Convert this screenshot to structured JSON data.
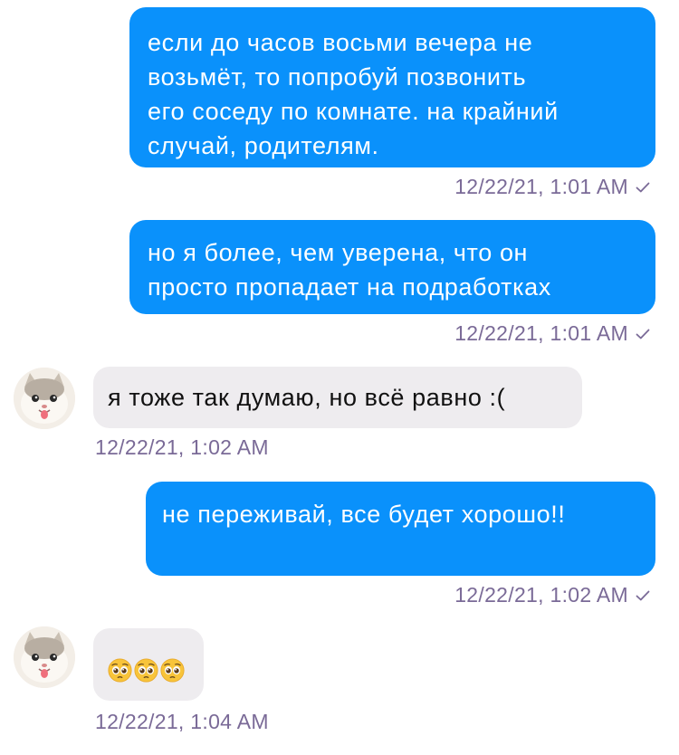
{
  "messages": [
    {
      "direction": "outgoing",
      "text": "если до часов восьми вечера не\nвозьмёт, то попробуй позвонить\nего соседу по комнате. на крайний\nслучай, родителям.",
      "timestamp": "12/22/21, 1:01 AM",
      "status_icon": "check-icon"
    },
    {
      "direction": "outgoing",
      "text": "но я более, чем уверена, что он\nпросто пропадает на подработках",
      "timestamp": "12/22/21, 1:01 AM",
      "status_icon": "check-icon"
    },
    {
      "direction": "incoming",
      "text": "я тоже так думаю, но всё равно :(",
      "timestamp": "12/22/21, 1:02 AM",
      "avatar_icon": "cat-avatar"
    },
    {
      "direction": "outgoing",
      "text": "не переживай, все будет хорошо!!",
      "timestamp": "12/22/21, 1:02 AM",
      "status_icon": "check-icon"
    },
    {
      "direction": "incoming",
      "emojis": [
        "pleading-face-emoji",
        "pleading-face-emoji",
        "pleading-face-emoji"
      ],
      "timestamp": "12/22/21, 1:04 AM",
      "avatar_icon": "cat-avatar"
    }
  ],
  "colors": {
    "outgoing_bubble": "#0a91fb",
    "incoming_bubble": "#eeecef",
    "timestamp": "#7a6a97",
    "background": "#ffffff"
  }
}
